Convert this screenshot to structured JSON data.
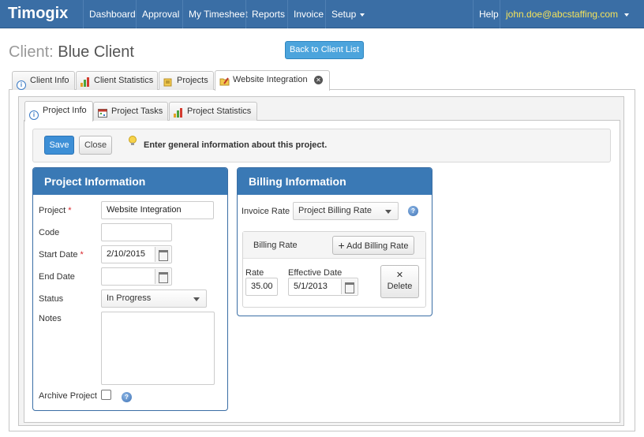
{
  "navbar": {
    "brand": "Timogix",
    "items": [
      "Dashboard",
      "Approval",
      "My Timesheet",
      "Reports",
      "Invoice",
      "Setup"
    ],
    "help": "Help",
    "user_email": "john.doe@abcstaffing.com"
  },
  "header": {
    "client_prefix": "Client:",
    "client_name": "Blue Client",
    "back_button": "Back to Client List"
  },
  "outer_tabs": [
    {
      "label": "Client Info",
      "icon": "info-icon"
    },
    {
      "label": "Client Statistics",
      "icon": "bar-chart-icon"
    },
    {
      "label": "Projects",
      "icon": "notes-icon"
    },
    {
      "label": "Website Integration",
      "icon": "folder-edit-icon",
      "active": true
    }
  ],
  "inner_tabs": [
    {
      "label": "Project Info",
      "icon": "info-icon",
      "active": true
    },
    {
      "label": "Project Tasks",
      "icon": "calendar-icon"
    },
    {
      "label": "Project Statistics",
      "icon": "bar-chart-icon"
    }
  ],
  "toolbar": {
    "save_label": "Save",
    "close_label": "Close",
    "hint": "Enter general information about this project."
  },
  "project_info": {
    "title": "Project Information",
    "project_label": "Project",
    "project_value": "Website Integration",
    "code_label": "Code",
    "code_value": "",
    "start_date_label": "Start Date",
    "start_date_value": "2/10/2015",
    "end_date_label": "End Date",
    "end_date_value": "",
    "status_label": "Status",
    "status_value": "In Progress",
    "notes_label": "Notes",
    "notes_value": "",
    "archive_label": "Archive Project",
    "archive_checked": false
  },
  "billing_info": {
    "title": "Billing Information",
    "invoice_rate_label": "Invoice Rate",
    "invoice_rate_value": "Project Billing Rate",
    "billing_rate_label": "Billing Rate",
    "add_billing_rate_label": "Add Billing Rate",
    "rate_label": "Rate",
    "rate_value": "35.00",
    "effective_date_label": "Effective Date",
    "effective_date_value": "5/1/2013",
    "delete_label": "Delete"
  },
  "colors": {
    "navbar": "#3a6ea5",
    "card_header": "#3a79b5",
    "primary_button": "#3d8fd6",
    "email": "#f5e35a",
    "required": "#d9262c"
  }
}
